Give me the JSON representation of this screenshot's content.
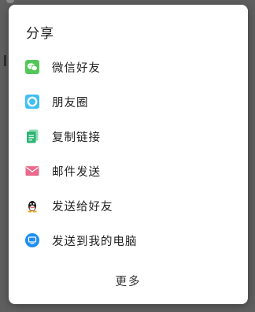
{
  "share_sheet": {
    "title": "分享",
    "items": [
      {
        "label": "微信好友",
        "icon": "wechat-icon",
        "color": "#55c759"
      },
      {
        "label": "朋友圈",
        "icon": "moments-icon",
        "color": "#3fc0f5"
      },
      {
        "label": "复制链接",
        "icon": "copy-link-icon",
        "color": "#2db574"
      },
      {
        "label": "邮件发送",
        "icon": "email-icon",
        "color": "#ea6a8c"
      },
      {
        "label": "发送给好友",
        "icon": "qq-icon",
        "color": "#1a1a1a"
      },
      {
        "label": "发送到我的电脑",
        "icon": "computer-icon",
        "color": "#1e8ef0"
      }
    ],
    "more_label": "更多"
  }
}
